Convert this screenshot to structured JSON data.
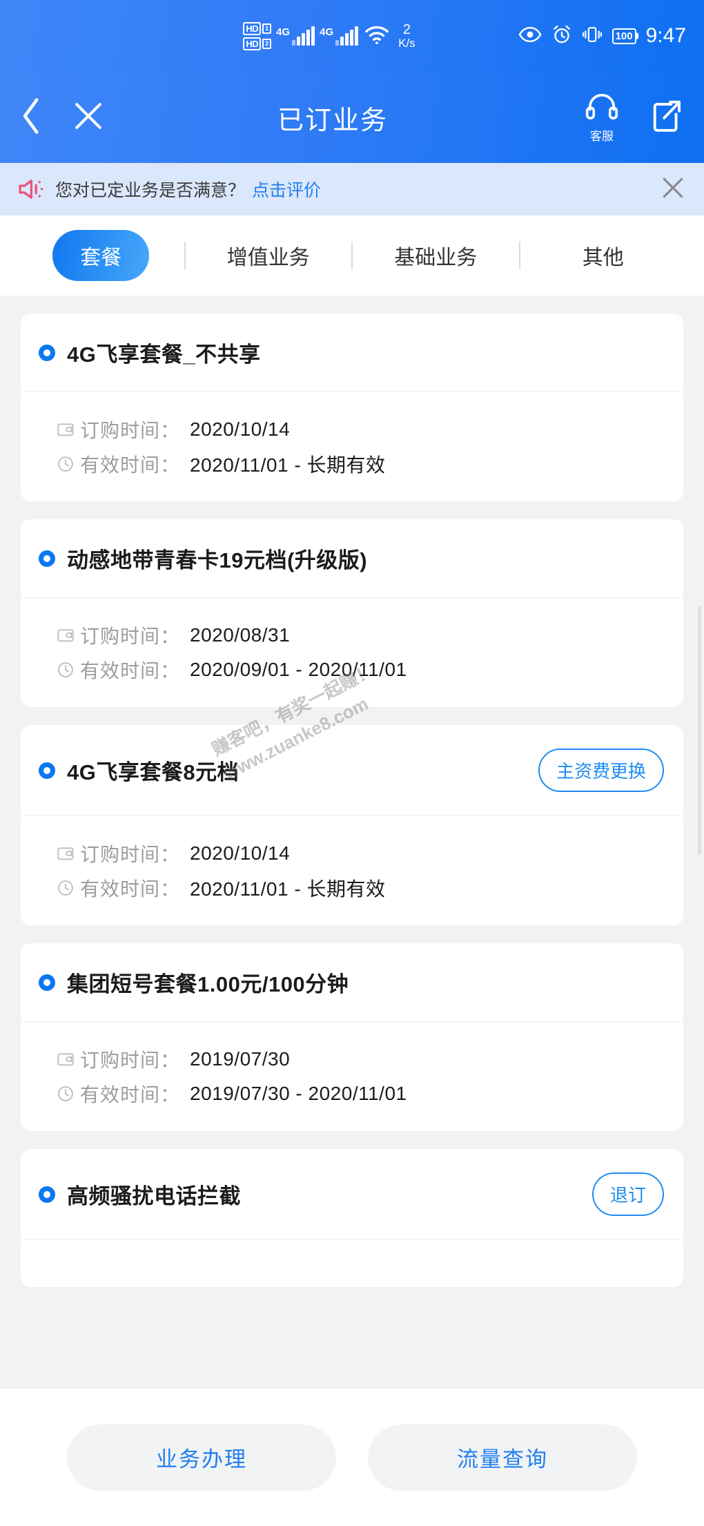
{
  "statusbar": {
    "hd1_label": "HD",
    "hd1_sub": "1",
    "hd2_label": "HD",
    "hd2_sub": "2",
    "sim1_net": "4G",
    "sim2_net": "4G",
    "netspeed_value": "2",
    "netspeed_unit": "K/s",
    "eye_icon": "eye-icon",
    "alarm_icon": "alarm-clock-icon",
    "vibrate_icon": "vibrate-icon",
    "battery_level": "100",
    "time": "9:47"
  },
  "titlebar": {
    "back_icon": "chevron-left-icon",
    "close_icon": "close-icon",
    "title": "已订业务",
    "service_label": "客服",
    "service_icon": "headset-icon",
    "share_icon": "share-icon"
  },
  "notice": {
    "speaker_icon": "megaphone-icon",
    "text": "您对已定业务是否满意？",
    "link": "点击评价",
    "close_icon": "close-icon"
  },
  "tabs": [
    {
      "label": "套餐",
      "active": true
    },
    {
      "label": "增值业务",
      "active": false
    },
    {
      "label": "基础业务",
      "active": false
    },
    {
      "label": "其他",
      "active": false
    }
  ],
  "labels": {
    "order_time": "订购时间：",
    "valid_time": "有效时间："
  },
  "cards": [
    {
      "title": "4G飞享套餐_不共享",
      "action": null,
      "order_time": "2020/10/14",
      "valid_time": "2020/11/01 - 长期有效"
    },
    {
      "title": "动感地带青春卡19元档(升级版)",
      "action": null,
      "order_time": "2020/08/31",
      "valid_time": "2020/09/01 - 2020/11/01"
    },
    {
      "title": "4G飞享套餐8元档",
      "action": "主资费更换",
      "order_time": "2020/10/14",
      "valid_time": "2020/11/01 - 长期有效"
    },
    {
      "title": "集团短号套餐1.00元/100分钟",
      "action": null,
      "order_time": "2019/07/30",
      "valid_time": "2019/07/30 - 2020/11/01"
    },
    {
      "title": "高频骚扰电话拦截",
      "action": "退订",
      "order_time": null,
      "valid_time": null
    }
  ],
  "watermark": {
    "line1": "赚客吧，有奖一起赚！",
    "line2": "www.zuanke8.com"
  },
  "bottombar": {
    "left_button": "业务办理",
    "right_button": "流量查询"
  },
  "colors": {
    "header_start": "#3f86f8",
    "header_end": "#0e6ff2",
    "accent_blue": "#1f7ff0",
    "bullet_blue": "#0b78ef",
    "notice_bg": "#dbe7fb",
    "notice_icon": "#e8547d",
    "page_bg": "#f2f2f2",
    "card_bg": "#ffffff"
  }
}
